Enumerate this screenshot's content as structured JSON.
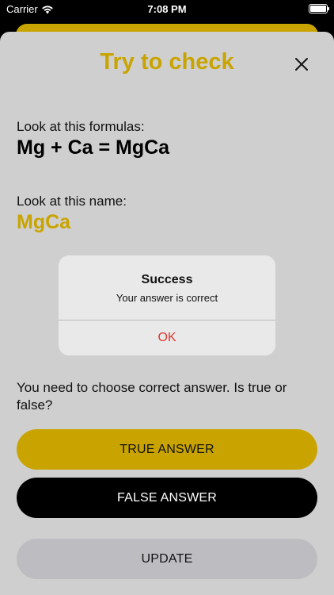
{
  "status_bar": {
    "carrier": "Carrier",
    "time": "7:08 PM"
  },
  "sheet": {
    "title": "Try to check",
    "formula_label": "Look at this formulas:",
    "formula": "Mg + Ca = MgCa",
    "name_label": "Look at this name:",
    "name_value": "MgCa",
    "question": "You need to choose correct answer. Is true or false?",
    "true_button": "TRUE ANSWER",
    "false_button": "FALSE ANSWER",
    "update_button": "UPDATE"
  },
  "alert": {
    "title": "Success",
    "message": "Your answer is correct",
    "ok_label": "OK"
  },
  "colors": {
    "accent": "#c9a400",
    "sheet_bg": "#cfcfcf",
    "destructive": "#e0362f"
  },
  "icons": {
    "close": "close-icon",
    "wifi": "wifi-icon",
    "battery": "battery-icon"
  }
}
